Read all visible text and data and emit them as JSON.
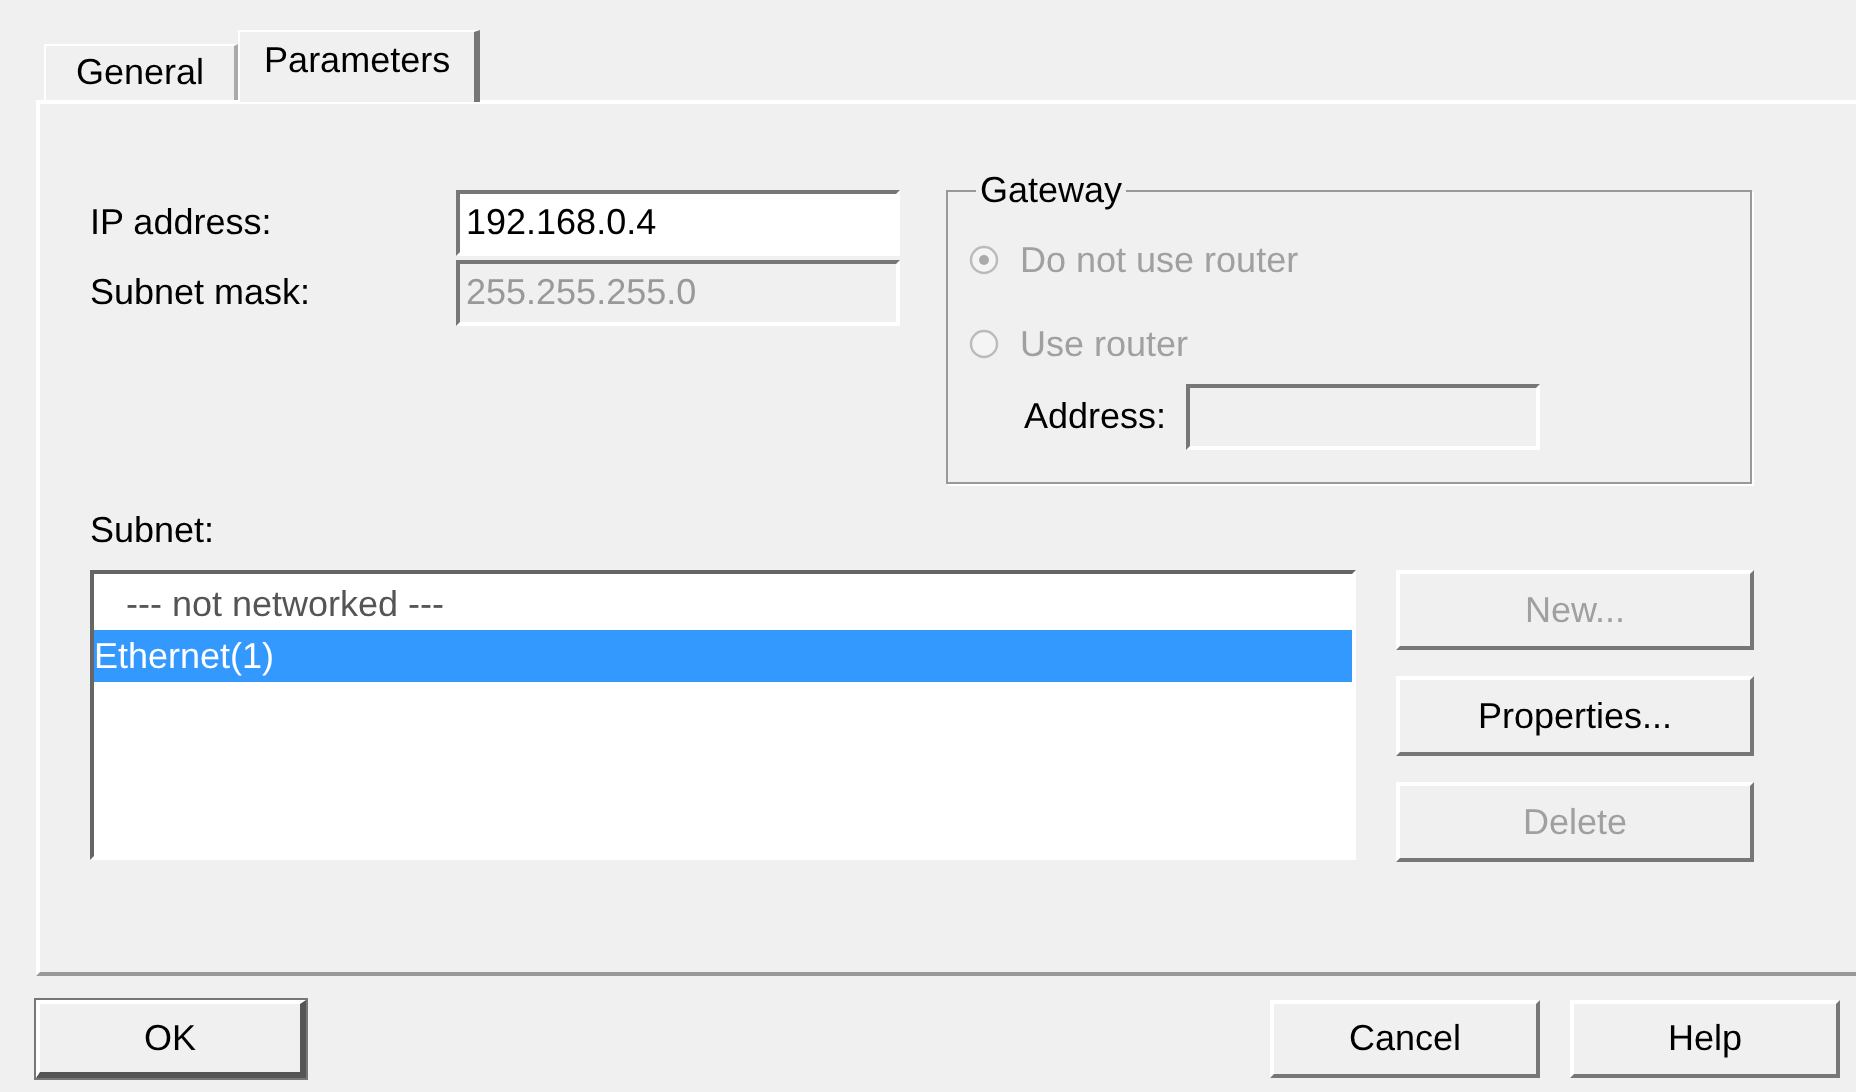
{
  "tabs": [
    {
      "label": "General",
      "selected": false
    },
    {
      "label": "Parameters",
      "selected": true
    }
  ],
  "fields": [
    {
      "label": "IP address:",
      "value": "192.168.0.4",
      "disabled": false
    },
    {
      "label": "Subnet mask:",
      "value": "255.255.255.0",
      "disabled": true
    }
  ],
  "gateway": {
    "title": "Gateway",
    "options": [
      {
        "label": "Do not use router",
        "selected": true,
        "disabled": true
      },
      {
        "label": "Use router",
        "selected": false,
        "disabled": true
      }
    ],
    "address": {
      "label": "Address:",
      "disabled": true
    }
  },
  "subnet": {
    "label": "Subnet:",
    "items": [
      {
        "label": "--- not networked ---",
        "selected": false
      },
      {
        "label": "Ethernet(1)",
        "selected": true
      }
    ]
  },
  "subnet_buttons": [
    {
      "label": "New...",
      "disabled": true
    },
    {
      "label": "Properties...",
      "disabled": false
    },
    {
      "label": "Delete",
      "disabled": true
    }
  ],
  "footer_buttons": [
    {
      "label": "OK",
      "default": true
    },
    {
      "label": "Cancel",
      "default": false
    },
    {
      "label": "Help",
      "default": false
    }
  ]
}
